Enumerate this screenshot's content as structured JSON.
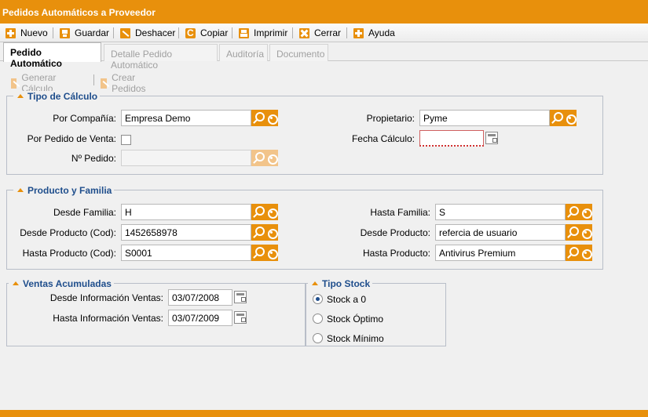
{
  "window": {
    "title": "Pedidos Automáticos a Proveedor"
  },
  "toolbar": {
    "nuevo": "Nuevo",
    "guardar": "Guardar",
    "deshacer": "Deshacer",
    "copiar": "Copiar",
    "imprimir": "Imprimir",
    "cerrar": "Cerrar",
    "ayuda": "Ayuda"
  },
  "tabs": [
    "Pedido Automático",
    "Detalle Pedido Automático",
    "Auditoría",
    "Documento"
  ],
  "actions": {
    "generar": "Generar Cálculo",
    "crear": "Crear Pedidos"
  },
  "tipo_calculo": {
    "title": "Tipo de Cálculo",
    "por_compania_label": "Por Compañía:",
    "por_compania_value": "Empresa Demo",
    "propietario_label": "Propietario:",
    "propietario_value": "Pyme",
    "por_pedido_venta_label": "Por Pedido de Venta:",
    "fecha_calculo_label": "Fecha Cálculo:",
    "fecha_calculo_value": "",
    "no_pedido_label": "Nº Pedido:",
    "no_pedido_value": ""
  },
  "producto_familia": {
    "title": "Producto y Familia",
    "desde_familia_label": "Desde Familia:",
    "desde_familia_value": "H",
    "hasta_familia_label": "Hasta Familia:",
    "hasta_familia_value": "S",
    "desde_producto_cod_label": "Desde Producto (Cod):",
    "desde_producto_cod_value": "1452658978",
    "desde_producto_label": "Desde Producto:",
    "desde_producto_value": "refercia de usuario",
    "hasta_producto_cod_label": "Hasta Producto (Cod):",
    "hasta_producto_cod_value": "S0001",
    "hasta_producto_label": "Hasta Producto:",
    "hasta_producto_value": "Antivirus Premium"
  },
  "ventas": {
    "title": "Ventas Acumuladas",
    "desde_label": "Desde Información Ventas:",
    "desde_value": "03/07/2008",
    "hasta_label": "Hasta Información Ventas:",
    "hasta_value": "03/07/2009"
  },
  "tipo_stock": {
    "title": "Tipo Stock",
    "options": [
      "Stock a 0",
      "Stock Óptimo",
      "Stock Mínimo"
    ],
    "selected": "Stock a 0"
  },
  "colors": {
    "accent": "#e8900c",
    "group_title": "#1f4e8c"
  }
}
